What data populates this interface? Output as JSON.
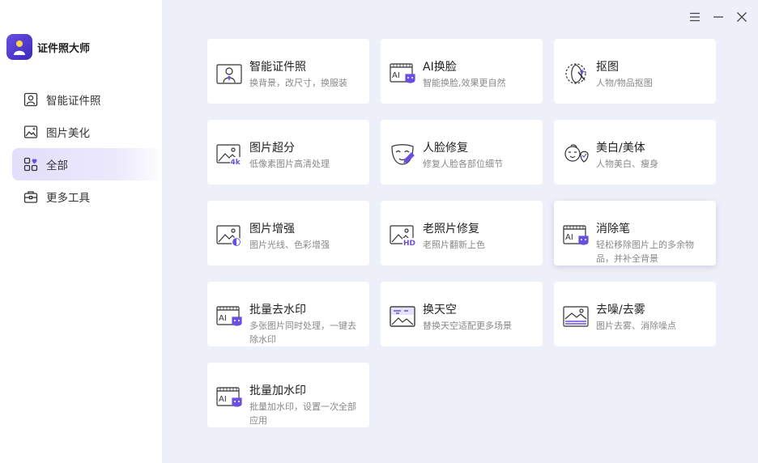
{
  "app": {
    "title": "证件照大师"
  },
  "sidebar": {
    "items": [
      {
        "label": "智能证件照",
        "icon": "id-photo-icon"
      },
      {
        "label": "图片美化",
        "icon": "image-beautify-icon"
      },
      {
        "label": "全部",
        "icon": "grid-all-icon",
        "active": true
      },
      {
        "label": "更多工具",
        "icon": "toolbox-icon"
      }
    ]
  },
  "window": {
    "menu": "menu-icon",
    "minimize": "minimize-icon",
    "close": "close-icon"
  },
  "tools": [
    {
      "title": "智能证件照",
      "desc": "换背景，改尺寸，换服装",
      "icon": "id-photo-icon"
    },
    {
      "title": "AI换脸",
      "desc": "智能换脸,效果更自然",
      "icon": "ai-face-swap-icon"
    },
    {
      "title": "抠图",
      "desc": "人物/物品抠图",
      "icon": "cutout-icon"
    },
    {
      "title": "图片超分",
      "desc": "低像素图片高清处理",
      "icon": "image-4k-icon"
    },
    {
      "title": "人脸修复",
      "desc": "修复人脸各部位细节",
      "icon": "face-repair-icon"
    },
    {
      "title": "美白/美体",
      "desc": "人物美白、瘦身",
      "icon": "beauty-icon"
    },
    {
      "title": "图片增强",
      "desc": "图片光线、色彩增强",
      "icon": "image-enhance-icon"
    },
    {
      "title": "老照片修复",
      "desc": "老照片翻新上色",
      "icon": "image-hd-icon"
    },
    {
      "title": "消除笔",
      "desc": "轻松移除图片上的多余物品，并补全背景",
      "icon": "ai-eraser-icon"
    },
    {
      "title": "批量去水印",
      "desc": "多张图片同时处理，一键去除水印",
      "icon": "ai-watermark-remove-icon"
    },
    {
      "title": "换天空",
      "desc": "替换天空适配更多场景",
      "icon": "sky-replace-icon"
    },
    {
      "title": "去噪/去雾",
      "desc": "图片去雾、消除噪点",
      "icon": "denoise-icon"
    },
    {
      "title": "批量加水印",
      "desc": "批量加水印，设置一次全部应用",
      "icon": "ai-watermark-add-icon"
    }
  ],
  "colors": {
    "accent": "#6b4fe0",
    "active_bg": "#e7e2fb",
    "page_bg": "#eef0f9"
  }
}
